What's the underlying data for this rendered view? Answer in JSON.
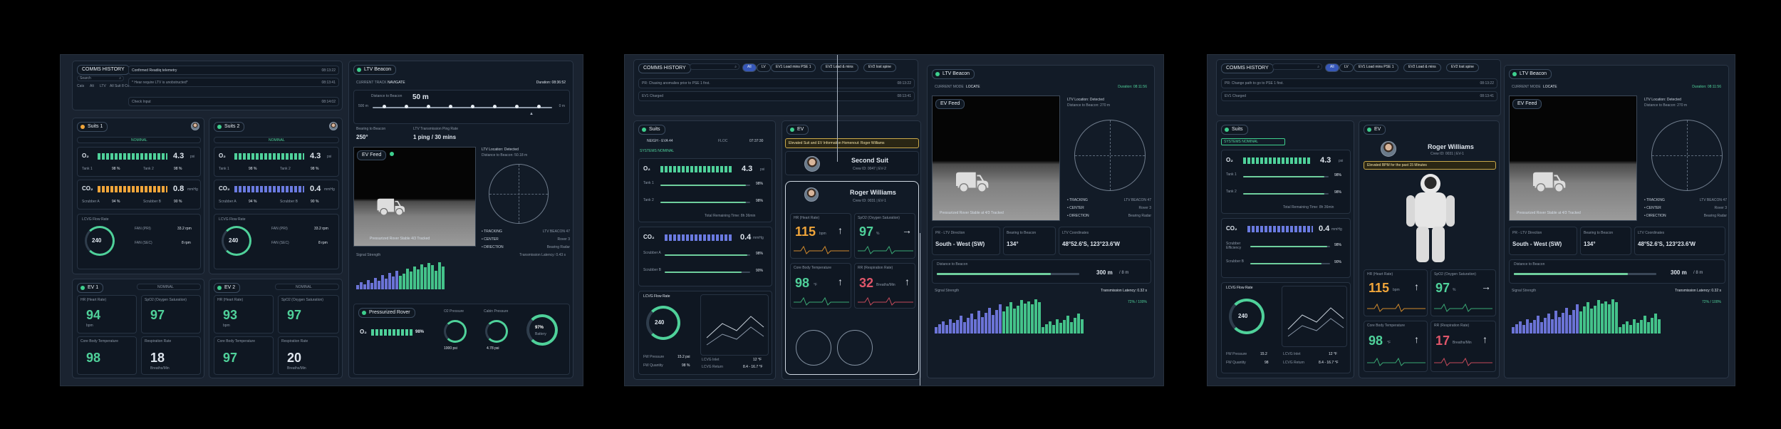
{
  "left": {
    "comms": {
      "title": "COMMS HISTORY",
      "search": "Search",
      "filters": [
        "Cats",
        "Alt",
        "LTV",
        "All Suit 8 Cmds",
        "LTV"
      ],
      "messages": [
        {
          "text": "Confirmed Readiiq telemetry",
          "time": "08:13:22"
        },
        {
          "text": "*  Hear require LTV is unobstructed*",
          "time": "08:13:41"
        },
        {
          "text": "Check Input",
          "time": "08:14:02"
        }
      ]
    },
    "beacon": {
      "title": "LTV Beacon",
      "mode_label": "CURRENT TRACK",
      "mode": "NAVIGATE",
      "duration": "Duration: 08:36:52",
      "distance_label": "Distance to Beacon",
      "distance": "50 m",
      "scale_left": "500 m",
      "scale_right": "0 m",
      "bearing_label": "Bearing to Beacon",
      "bearing": "250°",
      "ping_label": "LTV Transmission Ping Rate",
      "ping": "1 ping / 30 mins",
      "feed": "EV Feed",
      "feed_caption": "Pressurized Rover Stable 4/3 Tracked",
      "ltv_location": "LTV Location: Detected",
      "ltv_dist": "Distance to Beacon: 50.18 m",
      "legend": [
        {
          "l": "TRACKING",
          "r": "LTV BEACON 47"
        },
        {
          "l": "CENTER",
          "r": "Rover 3"
        },
        {
          "l": "DIRECTION",
          "r": "Bearing Radar"
        }
      ],
      "signal": "Signal Strength",
      "signal_right": "Transmission Latency: 0.43 s",
      "rover": "Pressurized Rover",
      "o2": "O₂",
      "o2_val": "98%",
      "g1": "O2 Pressure",
      "g1v": "1000 psi",
      "g2": "Cabin Pressure",
      "g2v": "4.78 psi",
      "battery": "97%",
      "battery_label": "Battery"
    },
    "suit1": {
      "title": "Suits 1",
      "status": "NOMINAL",
      "o2": "O₂",
      "o2v": "4.3",
      "o2u": "psi",
      "tank1": "Tank 1",
      "t1v": "98 %",
      "tank2": "Tank 2",
      "t2v": "98 %",
      "co2": "CO₂",
      "co2v": "0.8",
      "co2u": "mmHg",
      "s1": "Scrubber A",
      "s1v": "94 %",
      "s2": "Scrubber B",
      "s2v": "90 %",
      "flow": "LCVG Flow Rate",
      "flowv": "240",
      "fan1": "FAN (PRI)",
      "fan1v": "33.2 rpm",
      "fan2": "FAN (SEC)",
      "fan2v": "8 rpm"
    },
    "suit2": {
      "title": "Suits 2",
      "status": "NOMINAL",
      "o2v": "4.3",
      "t1v": "98 %",
      "t2v": "98 %",
      "co2v": "0.4",
      "s1v": "94 %",
      "s2v": "90 %",
      "flowv": "240",
      "fan1v": "33.2 rpm",
      "fan2v": "8 rpm"
    },
    "ev1": {
      "title": "EV 1",
      "status": "NOMINAL",
      "hr": "HR (Heart Rate)",
      "hrv": "94",
      "spo2": "SpO2 (Oxygen Saturation)",
      "spo2v": "97",
      "temp": "Core Body Temperature",
      "tempv": "98",
      "resp": "Respiration Rate",
      "respv": "18",
      "hru": "bpm",
      "respu": "Breaths/Min"
    },
    "ev2": {
      "title": "EV 2",
      "status": "NOMINAL",
      "hrv": "93",
      "spo2v": "97",
      "tempv": "97",
      "respv": "20"
    }
  },
  "mid": {
    "comms": {
      "title": "COMMS HISTORY",
      "filters": [
        "All",
        "LV",
        "EV1 Load mins PSE 1",
        "EV2 Load & mins",
        "EV2 lost spine"
      ],
      "messages": [
        {
          "text": "PR: Chasing anomalies prior to PSE 1 first.",
          "time": "08:13:22"
        },
        {
          "text": "EV1 Charged",
          "time": "08:13:41"
        }
      ]
    },
    "suits": {
      "title": "Suits",
      "nameplate": "NEIGH - EVA 44",
      "crew": "FLOC",
      "time": "07:37:30",
      "status": "SYSTEMS NOMINAL",
      "o2": "O₂",
      "o2v": "4.3",
      "o2u": "psi",
      "tank1": "Tank 1",
      "t1v": "98%",
      "tank2": "Tank 2",
      "t2v": "98%",
      "remaining": "Total Remaining Time: 8h 36min",
      "co2": "CO₂",
      "co2v": "0.4",
      "co2u": "mmHg",
      "s1": "Scrubber A",
      "s1v": "98%",
      "s2": "Scrubber B",
      "s2v": "90%",
      "flow": "LCVG Flow Rate",
      "flowv": "240",
      "fw1": "FW Pressure",
      "fw1v": "15.2 psi",
      "fw2": "FW Quantity",
      "fw2v": "98 %",
      "lc1": "LCVG Inlet",
      "lc1v": "12 °F",
      "lc2": "LCVG Return",
      "lc2v": "8.4 - 16.7 °F"
    },
    "ev": {
      "title": "EV",
      "alert": "Elevated Suit and EV Information Homenout: Roger Williams",
      "second": "Second Suit",
      "second_sub": "Crew ID: 0047 | EV-2",
      "name": "Roger Williams",
      "name_sub": "Crew ID: 0031 | EV-1",
      "hr": "HR (Heart Rate)",
      "hrv": "115",
      "hru": "bpm",
      "spo2": "SpO2 (Oxygen Saturation)",
      "spo2v": "97",
      "spo2u": "%",
      "temp": "Core Body Temperature",
      "tempv": "98",
      "tempu": "°F",
      "resp": "RR (Respiration Rate)",
      "respv": "32",
      "respu": "Breaths/Min"
    },
    "beacon": {
      "title": "LTV Beacon",
      "mode_label": "CURRENT MODE",
      "mode": "LOCATE",
      "duration": "Duration: 08:11:56",
      "feed": "EV Feed",
      "ltv": "LTV Location: Detected",
      "ltvd": "Distance to Beacon: 270 m",
      "caption": "Pressurized Rover Stable at 4/3 Tracked",
      "legend": [
        {
          "l": "TRACKING",
          "r": "LTV BEACON 47"
        },
        {
          "l": "CENTER",
          "r": "Rover 3"
        },
        {
          "l": "DIRECTION",
          "r": "Bearing Radar"
        }
      ],
      "dir_label": "PR - LTV Direction",
      "dir": "South - West (SW)",
      "bear_label": "Bearing to Beacon",
      "bear": "134°",
      "coord_label": "LTV Coordinates",
      "coord": "48°52.6'S, 123°23.6'W",
      "dist_label": "Distance to Beacon",
      "dist": "300 m",
      "dist_total": "/ 8 m",
      "signal": "Signal Strength",
      "latency": "Transmission Latency: 0.32 s",
      "pct": "72% / 100%"
    }
  },
  "right": {
    "comms": {
      "title": "COMMS HISTORY",
      "filters": [
        "All",
        "LV",
        "EV1 Load mins PSE 1",
        "EV2 Load & mins",
        "EV2 lost spine"
      ],
      "messages": [
        {
          "text": "PR: Change path to go to PSE 1 first.",
          "time": "08:13:22"
        },
        {
          "text": "EV1 Charged",
          "time": "08:13:41"
        }
      ]
    },
    "suits": {
      "title": "Suits",
      "status": "SYSTEMS NOMINAL",
      "o2v": "4.3",
      "co2v": "0.4",
      "t1v": "98%",
      "t2v": "98%",
      "s1": "Scrubber Efficiency",
      "s1v": "98%",
      "s2": "Scrubber B",
      "s2v": "90%",
      "remaining": "Total Remaining Time: 8h 36min",
      "flowv": "240",
      "fw1v": "15.2",
      "fw2v": "98",
      "lc1v": "12 °F",
      "lc2v": "8.4 - 16.7 °F"
    },
    "ev": {
      "title": "EV",
      "name": "Roger Williams",
      "name_sub": "Crew ID: 0031 | EV-1",
      "alert": "Elevated BPM for the past 15 Minutes",
      "hrv": "115",
      "spo2v": "97",
      "tempv": "98",
      "respv": "17"
    },
    "beacon": {
      "title": "LTV Beacon",
      "mode": "LOCATE",
      "duration": "Duration: 08:11:56",
      "dir": "South - West (SW)",
      "bear": "134°",
      "coord": "48°52.6'S, 123°23.6'W",
      "dist": "300 m",
      "dist_total": "/ 8 m",
      "latency": "Transmission Latency: 0.32 s",
      "pct": "72% / 100%"
    }
  },
  "spark": [
    4,
    7,
    5,
    9,
    6,
    11,
    8,
    14,
    10,
    16,
    12,
    18,
    13,
    15,
    20,
    17,
    22,
    19,
    24,
    21,
    25,
    23,
    18,
    26,
    22
  ],
  "spark2": [
    6,
    9,
    12,
    8,
    14,
    10,
    13,
    17,
    11,
    15,
    19,
    14,
    22,
    16,
    20,
    25,
    18,
    23,
    28,
    21,
    26,
    30,
    24,
    27,
    32,
    29,
    31,
    28,
    33,
    30
  ]
}
